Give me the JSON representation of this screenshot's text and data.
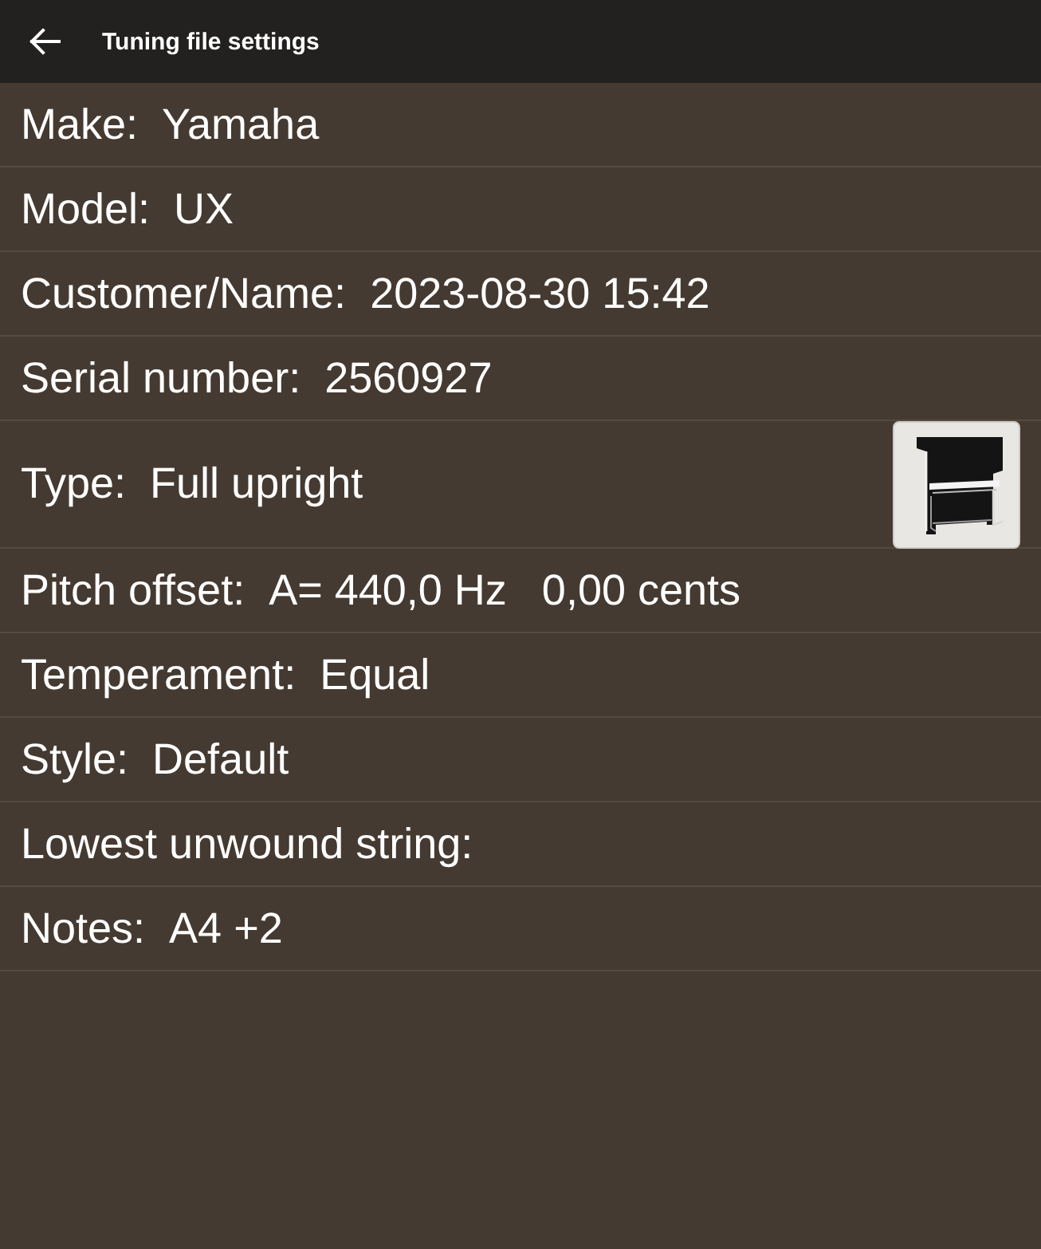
{
  "header": {
    "title": "Tuning file settings"
  },
  "fields": [
    {
      "kind": "plain",
      "label": "Make:",
      "values": [
        "Yamaha"
      ]
    },
    {
      "kind": "plain",
      "label": "Model:",
      "values": [
        "UX"
      ]
    },
    {
      "kind": "plain",
      "label": "Customer/Name:",
      "values": [
        "2023-08-30 15:42"
      ]
    },
    {
      "kind": "plain",
      "label": "Serial number:",
      "values": [
        "2560927"
      ]
    },
    {
      "kind": "picture",
      "label": "Type:",
      "values": [
        "Full upright"
      ]
    },
    {
      "kind": "plain",
      "label": "Pitch offset:",
      "values": [
        "A= 440,0 Hz",
        "0,00 cents"
      ]
    },
    {
      "kind": "plain",
      "label": "Temperament:",
      "values": [
        "Equal"
      ]
    },
    {
      "kind": "plain",
      "label": "Style:",
      "values": [
        "Default"
      ]
    },
    {
      "kind": "plain",
      "label": "Lowest unwound string:"
    },
    {
      "kind": "plain",
      "label": "Notes:",
      "values": [
        "A4 +2"
      ]
    }
  ]
}
